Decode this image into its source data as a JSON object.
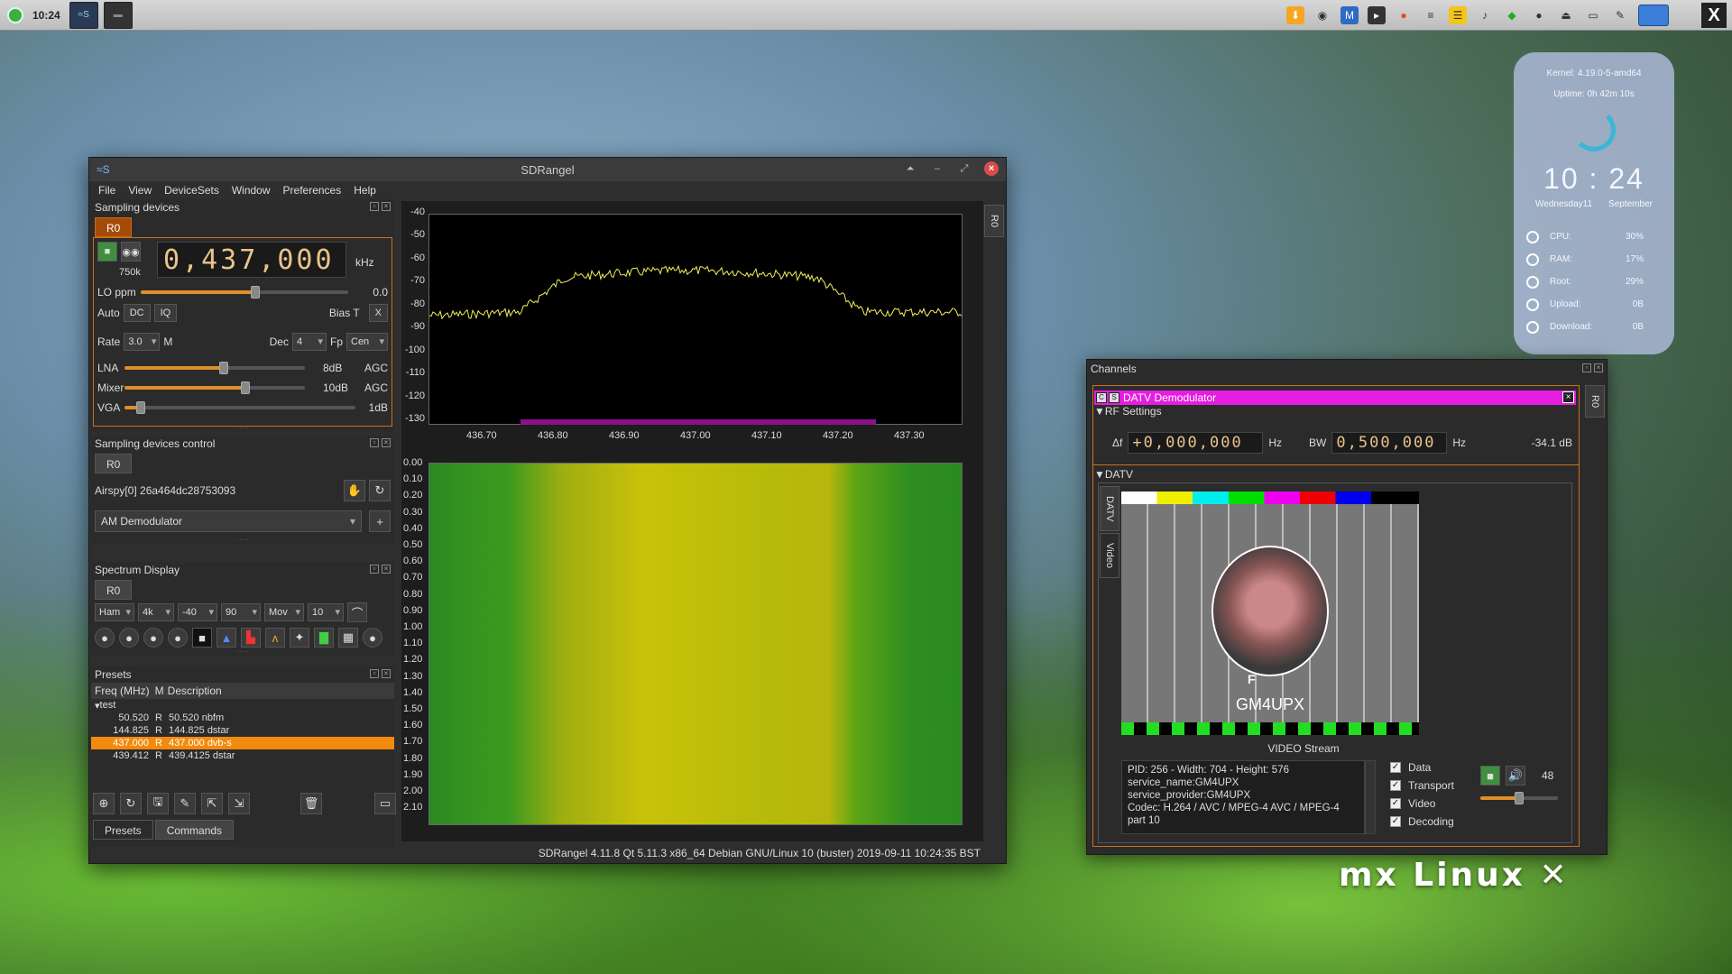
{
  "taskbar": {
    "clock": "10:24",
    "close_glyph": "X"
  },
  "conky": {
    "kernel": "Kernel: 4.19.0-5-amd64",
    "uptime": "Uptime: 0h 42m 10s",
    "time": "10 : 24",
    "day": "Wednesday11",
    "month": "September",
    "stats": [
      {
        "label": "CPU:",
        "value": "30%"
      },
      {
        "label": "RAM:",
        "value": "17%"
      },
      {
        "label": "Root:",
        "value": "29%"
      },
      {
        "label": "Upload:",
        "value": "0B"
      },
      {
        "label": "Download:",
        "value": "0B"
      }
    ]
  },
  "mainwin": {
    "title": "SDRangel",
    "menu": [
      "File",
      "View",
      "DeviceSets",
      "Window",
      "Preferences",
      "Help"
    ],
    "sampling_devices": {
      "title": "Sampling devices",
      "tab": "R0",
      "samplerate": "750k",
      "frequency": "0,437,000",
      "freq_unit": "kHz",
      "lo_ppm_label": "LO ppm",
      "lo_ppm_value": "0.0",
      "auto_label": "Auto",
      "dc_label": "DC",
      "iq_label": "IQ",
      "bias_label": "Bias T",
      "bias_x": "X",
      "rate_label": "Rate",
      "rate_value": "3.0",
      "rate_unit": "M",
      "dec_label": "Dec",
      "dec_value": "4",
      "fp_label": "Fp",
      "fp_value": "Cen",
      "lna_label": "LNA",
      "lna_value": "8dB",
      "lna_agc": "AGC",
      "mixer_label": "Mixer",
      "mixer_value": "10dB",
      "mixer_agc": "AGC",
      "vga_label": "VGA",
      "vga_value": "1dB",
      "lo_ppm_level": 0.55,
      "lna_level": 0.55,
      "mixer_level": 0.67,
      "vga_level": 0.07
    },
    "sampling_control": {
      "title": "Sampling devices control",
      "tab": "R0",
      "device": "Airspy[0] 26a464dc28753093",
      "demod": "AM Demodulator"
    },
    "spectrum_display": {
      "title": "Spectrum Display",
      "tab": "R0",
      "combos": [
        "Ham",
        "4k",
        "-40",
        "90",
        "Mov",
        "10"
      ]
    },
    "presets": {
      "title": "Presets",
      "col_freq": "Freq (MHz)",
      "col_m": "M",
      "col_desc": "Description",
      "group": "test",
      "rows": [
        {
          "freq": "50.520",
          "m": "R",
          "desc": "50.520 nbfm",
          "selected": false
        },
        {
          "freq": "144.825",
          "m": "R",
          "desc": "144.825 dstar",
          "selected": false
        },
        {
          "freq": "437.000",
          "m": "R",
          "desc": "437.000 dvb-s",
          "selected": true
        },
        {
          "freq": "439.412",
          "m": "R",
          "desc": "439.4125 dstar",
          "selected": false
        }
      ],
      "tab_presets": "Presets",
      "tab_commands": "Commands"
    },
    "spectrum": {
      "y_ticks": [
        "-40",
        "-50",
        "-60",
        "-70",
        "-80",
        "-90",
        "-100",
        "-110",
        "-120",
        "-130"
      ],
      "x_ticks": [
        "436.70",
        "436.80",
        "436.90",
        "437.00",
        "437.10",
        "437.20",
        "437.30"
      ],
      "wf_ticks": [
        "0.00",
        "0.10",
        "0.20",
        "0.30",
        "0.40",
        "0.50",
        "0.60",
        "0.70",
        "0.80",
        "0.90",
        "1.00",
        "1.10",
        "1.20",
        "1.30",
        "1.40",
        "1.50",
        "1.60",
        "1.70",
        "1.80",
        "1.90",
        "2.00",
        "2.10"
      ],
      "side_tab": "R0"
    },
    "status": "SDRangel 4.11.8 Qt 5.11.3 x86_64 Debian GNU/Linux 10 (buster)  2019-09-11 10:24:35 BST"
  },
  "channels": {
    "title": "Channels",
    "demod_title": "DATV Demodulator",
    "side_tab": "R0",
    "rf_settings": "RF Settings",
    "delta_label": "Δf",
    "delta_value": "+0,000,000",
    "delta_unit": "Hz",
    "bw_label": "BW",
    "bw_value": "0,500,000",
    "bw_unit": "Hz",
    "power": "-34.1 dB",
    "datv_hdr": "DATV",
    "tab_datv": "DATV",
    "tab_video": "Video",
    "testcard_callsign": "GM4UPX",
    "testcard_letter": "F",
    "video_stream": "VIDEO Stream",
    "info_lines": [
      "PID: 256 - Width: 704 - Height: 576",
      "service_name:GM4UPX",
      "service_provider:GM4UPX",
      "Codec: H.264 / AVC / MPEG-4 AVC / MPEG-4",
      "part 10"
    ],
    "checks": [
      "Data",
      "Transport",
      "Video",
      "Decoding"
    ],
    "volume": "48"
  },
  "brand": "MX Linux"
}
